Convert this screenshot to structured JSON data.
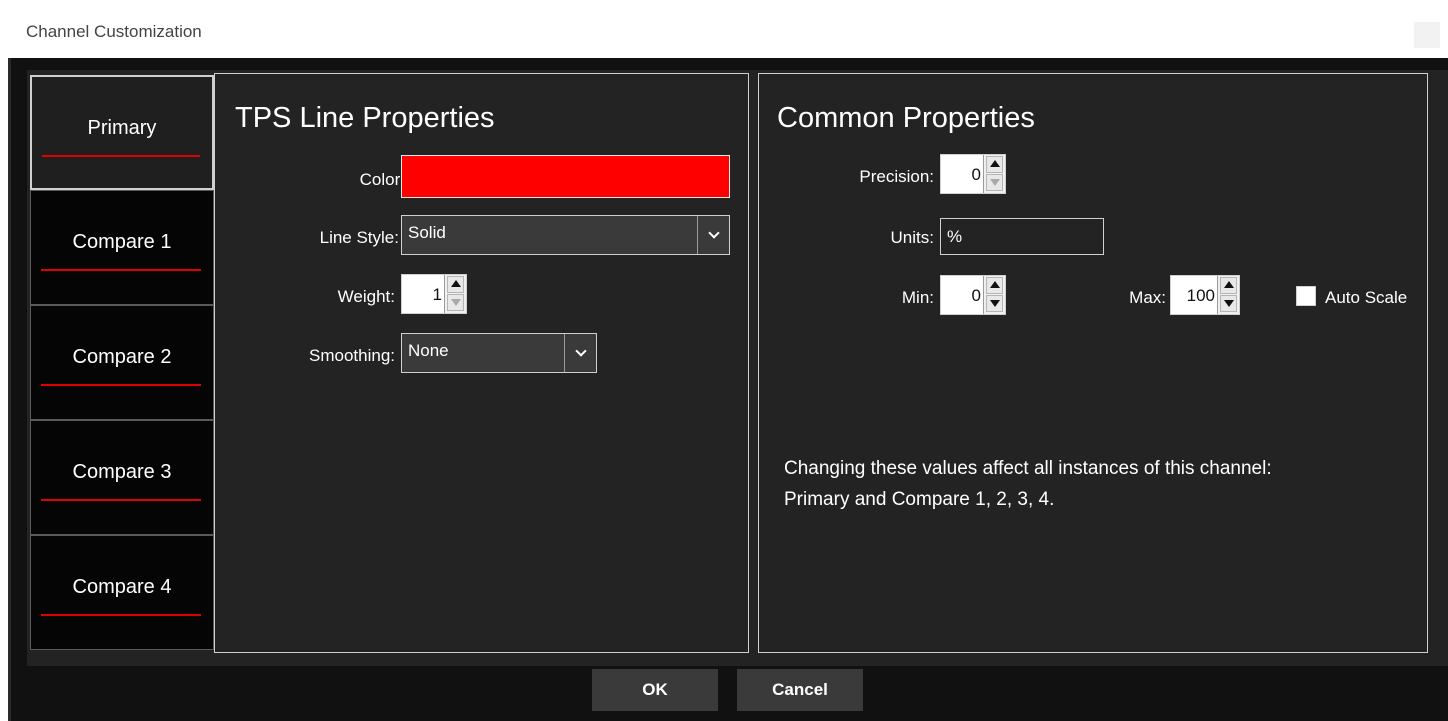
{
  "window": {
    "title": "Channel Customization"
  },
  "tabs": [
    {
      "label": "Primary",
      "active": true,
      "line_color": "#e00000"
    },
    {
      "label": "Compare 1",
      "active": false,
      "line_color": "#e00000"
    },
    {
      "label": "Compare 2",
      "active": false,
      "line_color": "#e00000"
    },
    {
      "label": "Compare 3",
      "active": false,
      "line_color": "#e00000"
    },
    {
      "label": "Compare 4",
      "active": false,
      "line_color": "#e00000"
    }
  ],
  "line_properties": {
    "title": "TPS Line Properties",
    "color_label": "Color:",
    "color_value": "#ff0000",
    "line_style_label": "Line Style:",
    "line_style_value": "Solid",
    "weight_label": "Weight:",
    "weight_value": "1",
    "smoothing_label": "Smoothing:",
    "smoothing_value": "None"
  },
  "common_properties": {
    "title": "Common Properties",
    "precision_label": "Precision:",
    "precision_value": "0",
    "units_label": "Units:",
    "units_value": "%",
    "min_label": "Min:",
    "min_value": "0",
    "max_label": "Max:",
    "max_value": "100",
    "auto_scale_label": "Auto Scale",
    "auto_scale_checked": false,
    "note_line1": "Changing these values affect all instances of this channel:",
    "note_line2": "Primary and Compare 1, 2, 3, 4."
  },
  "buttons": {
    "ok": "OK",
    "cancel": "Cancel"
  }
}
